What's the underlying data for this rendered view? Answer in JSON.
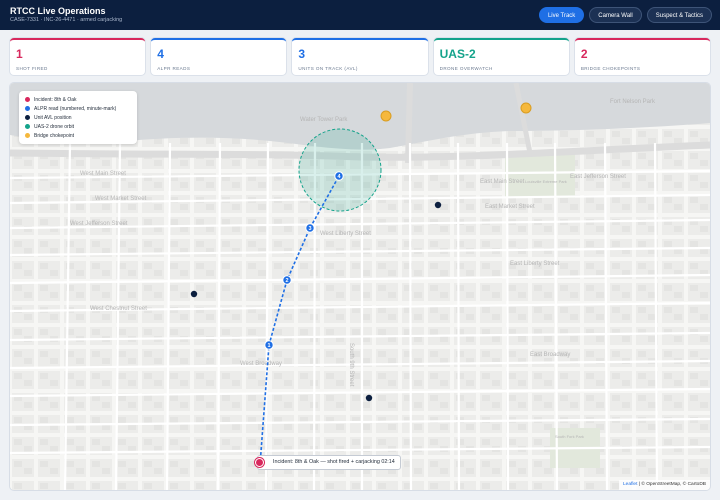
{
  "header": {
    "title": "RTCC Live Operations",
    "subtitle": "CASE-7331 · INC-26-4471 · armed carjacking",
    "buttons": [
      {
        "label": "Live Track",
        "active": true
      },
      {
        "label": "Camera Wall",
        "active": false
      },
      {
        "label": "Suspect & Tactics",
        "active": false
      }
    ]
  },
  "stats": [
    {
      "value": "1",
      "label": "SHOT FIRED",
      "color": "#d8285d"
    },
    {
      "value": "4",
      "label": "ALPR READS",
      "color": "#1f6fe5"
    },
    {
      "value": "3",
      "label": "UNITS ON TRACK (AVL)",
      "color": "#1f6fe5"
    },
    {
      "value": "UAS-2",
      "label": "DRONE OVERWATCH",
      "color": "#14a38b"
    },
    {
      "value": "2",
      "label": "BRIDGE CHOKEPOINTS",
      "color": "#d8285d"
    }
  ],
  "legend": [
    {
      "label": "Incident: 8th & Oak",
      "color": "#d8285d"
    },
    {
      "label": "ALPR read (numbered, minute-mark)",
      "color": "#1f6fe5"
    },
    {
      "label": "Unit AVL position",
      "color": "#0c1f3f"
    },
    {
      "label": "UAS-2 drone orbit",
      "color": "#14a38b"
    },
    {
      "label": "Bridge chokepoint",
      "color": "#f5b83d"
    }
  ],
  "alpr_reads": [
    "1",
    "2",
    "3",
    "4"
  ],
  "streets": [
    "West Main Street",
    "West Market Street",
    "West Jefferson Street",
    "West Liberty Street",
    "West Chestnut Street",
    "West Broadway",
    "South 9th Street",
    "East Main Street",
    "East Market Street",
    "East Jefferson Street",
    "East Liberty Street",
    "East Broadway",
    "Water Tower Park",
    "Fort Nelson Park",
    "Louisville Extreme Park",
    "South Fork Park"
  ],
  "popup": "Incident: 8th & Oak — shot fired + carjacking 02:14",
  "attribution": {
    "leaflet": "Leaflet",
    "rest": " | © OpenStreetMap, © CartoDB"
  }
}
